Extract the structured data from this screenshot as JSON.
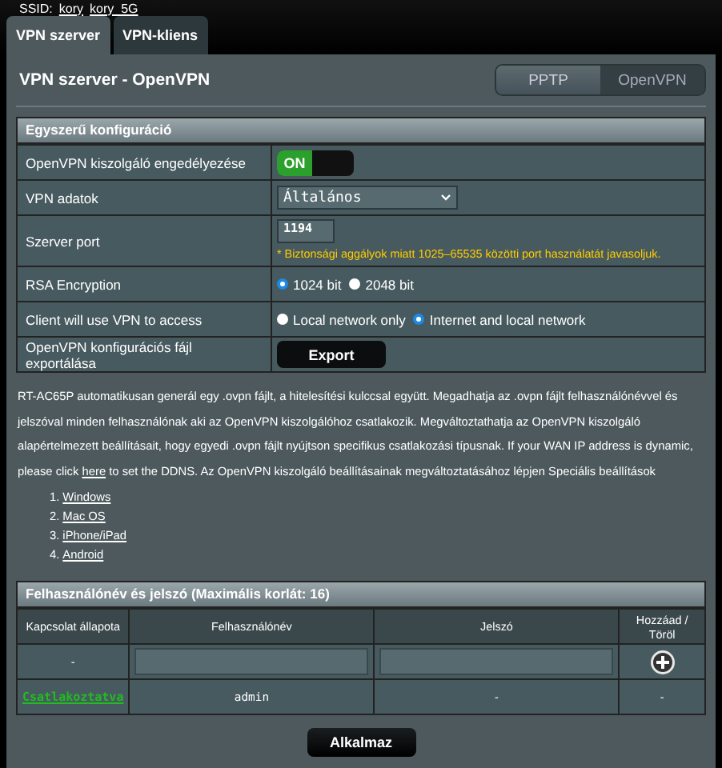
{
  "ssid": {
    "label": "SSID:",
    "networks": [
      "kory",
      "kory_5G"
    ]
  },
  "tabs": [
    {
      "label": "VPN szerver",
      "selected": true
    },
    {
      "label": "VPN-kliens",
      "selected": false
    }
  ],
  "title": "VPN szerver - OpenVPN",
  "mode_switch": [
    {
      "label": "PPTP",
      "selected": false
    },
    {
      "label": "OpenVPN",
      "selected": true
    }
  ],
  "basic_config": {
    "title": "Egyszerű konfiguráció",
    "rows": [
      {
        "kind": "toggle",
        "label": "OpenVPN kiszolgáló engedélyezése",
        "on": true,
        "on_text": "ON"
      },
      {
        "kind": "select",
        "label": "VPN adatok",
        "value": "Általános"
      },
      {
        "kind": "port",
        "label": "Szerver port",
        "value": "1194",
        "note": "* Biztonsági aggályok miatt 1025–65535 közötti port használatát javasoljuk."
      },
      {
        "kind": "radio",
        "label": "RSA Encryption",
        "options": [
          {
            "label": "1024 bit",
            "selected": true
          },
          {
            "label": "2048 bit",
            "selected": false
          }
        ]
      },
      {
        "kind": "radio",
        "label": "Client will use VPN to access",
        "options": [
          {
            "label": "Local network only",
            "selected": false
          },
          {
            "label": "Internet and local network",
            "selected": true
          }
        ]
      },
      {
        "kind": "button",
        "label": "OpenVPN konfigurációs fájl exportálása",
        "button": "Export"
      }
    ]
  },
  "description": {
    "before": "RT-AC65P automatikusan generál egy .ovpn fájlt, a hitelesítési kulccsal együtt. Megadhatja az .ovpn fájlt felhasználónévvel és jelszóval minden felhasználónak aki az OpenVPN kiszolgálóhoz csatlakozik. Megváltoztathatja az OpenVPN kiszolgáló alapértelmezett beállításait, hogy egyedi .ovpn fájlt nyújtson specifikus csatlakozási típusnak. If your WAN IP address is dynamic, please click",
    "link": "here",
    "after": "to set the DDNS. Az OpenVPN kiszolgáló beállításainak megváltoztatásához lépjen Speciális beállítások"
  },
  "os_links": [
    {
      "number": "1.",
      "label": "Windows"
    },
    {
      "number": "2.",
      "label": "Mac OS"
    },
    {
      "number": "3.",
      "label": "iPhone/iPad"
    },
    {
      "number": "4.",
      "label": "Android"
    }
  ],
  "users": {
    "title": "Felhasználónév és jelszó (Maximális korlát: 16)",
    "columns": [
      "Kapcsolat állapota",
      "Felhasználónév",
      "Jelszó",
      "Hozzáad / Töröl"
    ],
    "new_row": {
      "status": "-"
    },
    "rows": [
      {
        "status": "Csatlakoztatva",
        "connected": true,
        "username": "admin",
        "password": "-",
        "action": "-"
      }
    ]
  },
  "apply_button": "Alkalmaz"
}
